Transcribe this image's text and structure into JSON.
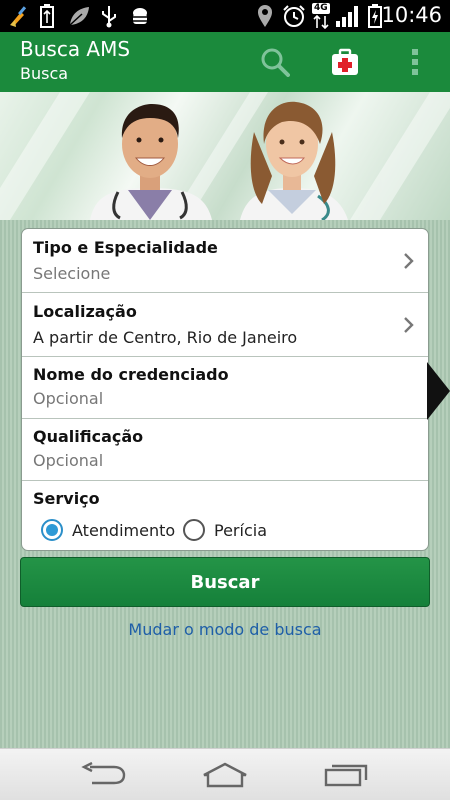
{
  "status_bar": {
    "time": "10:46",
    "network_label": "4G",
    "icons": [
      "broom-icon",
      "battery-usb-icon",
      "leaf-icon",
      "usb-icon",
      "android-debug-icon",
      "location-pin-icon",
      "alarm-icon",
      "data-arrows-icon",
      "signal-icon",
      "battery-charging-icon"
    ]
  },
  "app_bar": {
    "title": "Busca AMS",
    "subtitle": "Busca",
    "actions": [
      "search-icon",
      "medical-kit-icon",
      "overflow-menu-icon"
    ]
  },
  "form": {
    "rows": [
      {
        "label": "Tipo e Especialidade",
        "value": "Selecione"
      },
      {
        "label": "Localização",
        "value": "A partir de Centro, Rio de Janeiro"
      },
      {
        "label": "Nome do credenciado",
        "value": "Opcional"
      },
      {
        "label": "Qualificação",
        "value": "Opcional"
      }
    ],
    "service": {
      "label": "Serviço",
      "options": [
        {
          "label": "Atendimento",
          "selected": true
        },
        {
          "label": "Perícia",
          "selected": false
        }
      ]
    }
  },
  "search_button": "Buscar",
  "change_mode_link": "Mudar o modo de busca",
  "colors": {
    "primary_green": "#1b8a3c",
    "link_blue": "#1f5fa8",
    "radio_blue": "#2e9ad6",
    "cross_red": "#e0202a"
  }
}
